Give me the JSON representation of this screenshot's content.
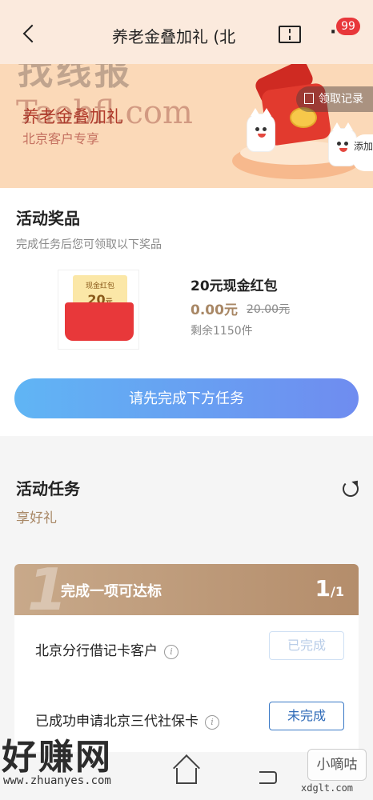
{
  "header": {
    "title": "养老金叠加礼 (北",
    "badge_count": "99",
    "more": "···"
  },
  "watermarks": {
    "top_chinese": "找线报",
    "top_url": "Taobfl.com",
    "bottom_left_name": "好赚网",
    "bottom_left_url": "www.zhuanyes.com",
    "bottom_right_name": "小嘀咕",
    "bottom_right_url": "xdglt.com"
  },
  "banner": {
    "title": "养老金叠加礼",
    "subtitle": "北京客户专享",
    "record_label": "领取记录",
    "add_label": "添加"
  },
  "rewards": {
    "heading": "活动奖品",
    "subheading": "完成任务后您可领取以下奖品",
    "prize": {
      "card_label": "现金红包",
      "card_amount": "20",
      "card_unit": "元",
      "name": "20元现金红包",
      "price": "0.00元",
      "original_price": "20.00元",
      "stock": "剩余1150件"
    },
    "cta_label": "请先完成下方任务"
  },
  "tasks": {
    "heading": "活动任务",
    "subheading": "享好礼",
    "group": {
      "number": "1",
      "title": "完成一项可达标",
      "progress_done": "1",
      "progress_total": "/1"
    },
    "items": [
      {
        "label": "北京分行借记卡客户",
        "status": "已完成"
      },
      {
        "label": "已成功申请北京三代社保卡",
        "status": "未完成"
      }
    ]
  },
  "colors": {
    "banner_bg": "#fbd9b8",
    "accent_blue": "#3a79c6",
    "cta_gradient_start": "#60b5f4",
    "cta_gradient_end": "#6f8cf0",
    "task_header": "#b48d6b",
    "price_gold": "#a88765",
    "badge_red": "#e8373a"
  }
}
